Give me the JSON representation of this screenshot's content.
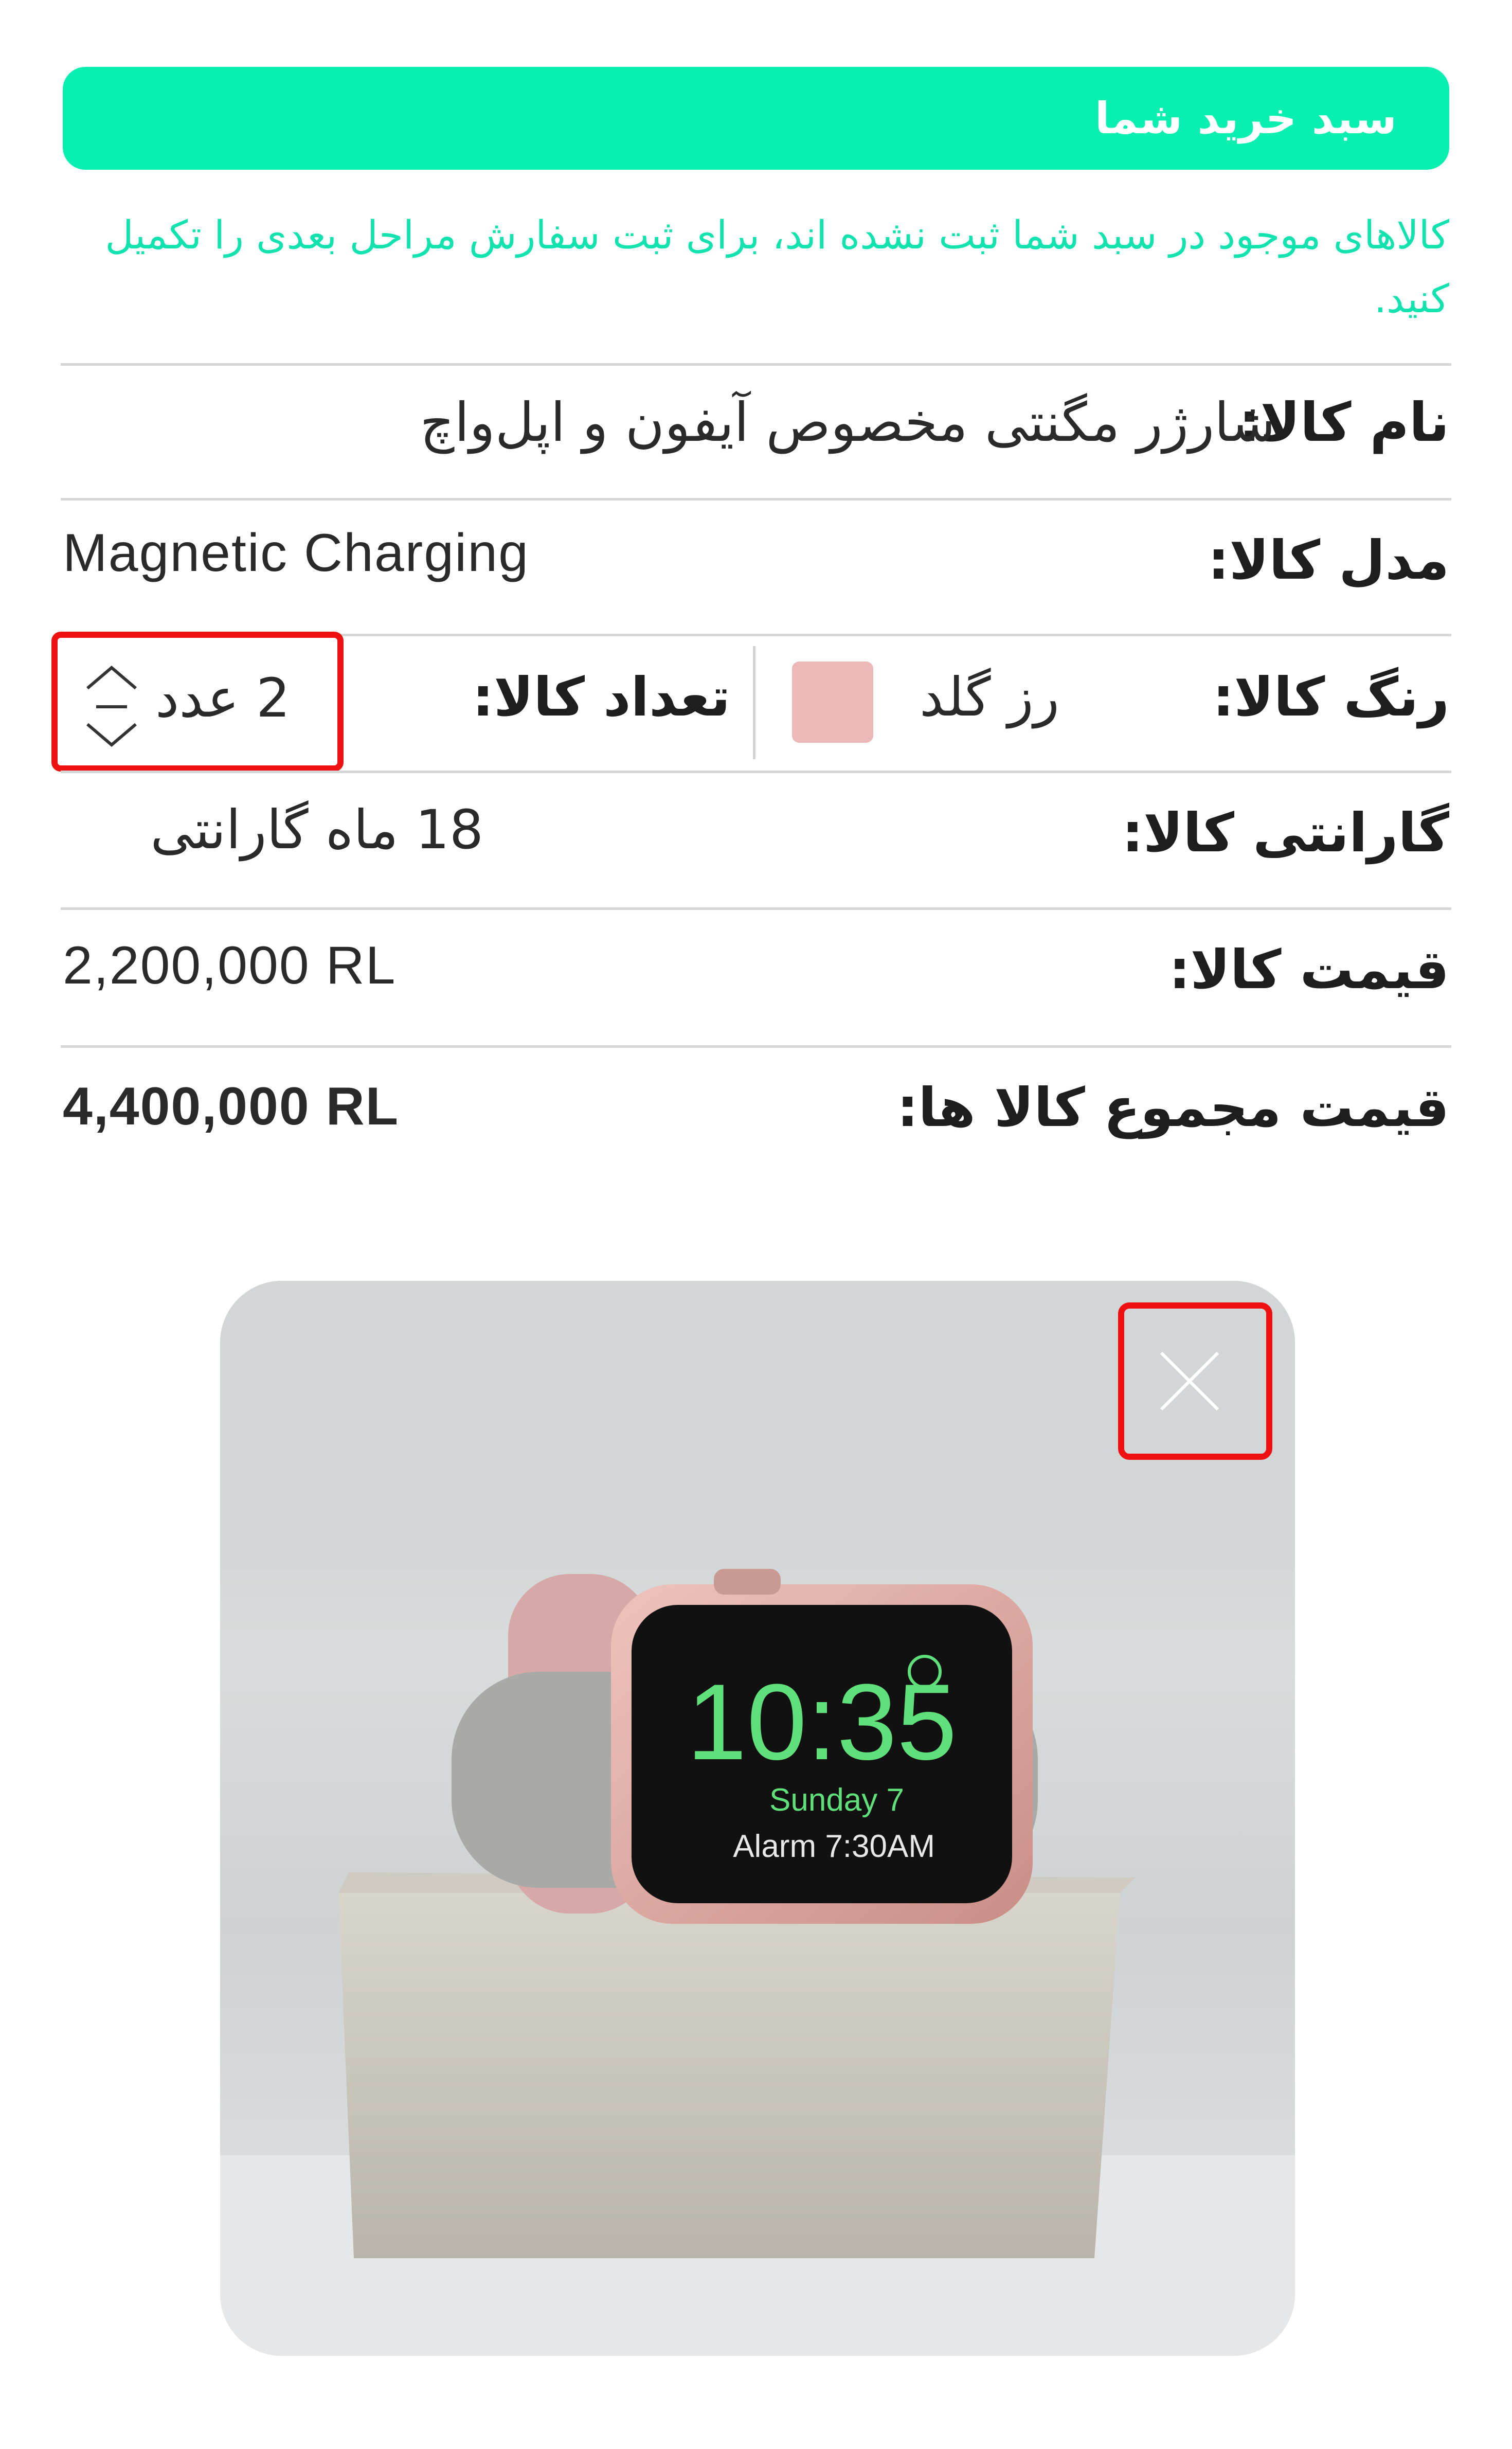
{
  "header": {
    "title": "سبد خرید شما"
  },
  "notice": {
    "text": "کالاهای موجود در سبد شما ثبت نشده اند، برای ثبت سفارش مراحل بعدی را تکمیل کنید."
  },
  "product": {
    "name_label": "نام کالا:",
    "name_value": "شارژر مگنتی مخصوص آیفون و اپل‌واچ",
    "model_label": "مدل کالا:",
    "model_value": "Magnetic Charging",
    "color_label": "رنگ کالا:",
    "color_value": "رز گلد",
    "color_swatch": "#ebb7b7",
    "quantity_label": "تعداد کالا:",
    "quantity_value": "2 عدد",
    "warranty_label": "گارانتی کالا:",
    "warranty_value": "18 ماه گارانتی",
    "price_label": "قیمت کالا:",
    "price_value": "2,200,000 RL",
    "total_label": "قیمت مجموع کالا ها:",
    "total_value": "4,400,000 RL"
  },
  "image": {
    "watch_time": "10:35",
    "watch_date": "Sunday 7",
    "watch_alarm": "Alarm 7:30AM"
  },
  "colors": {
    "accent": "#08efb0",
    "highlight": "#ee1111"
  }
}
